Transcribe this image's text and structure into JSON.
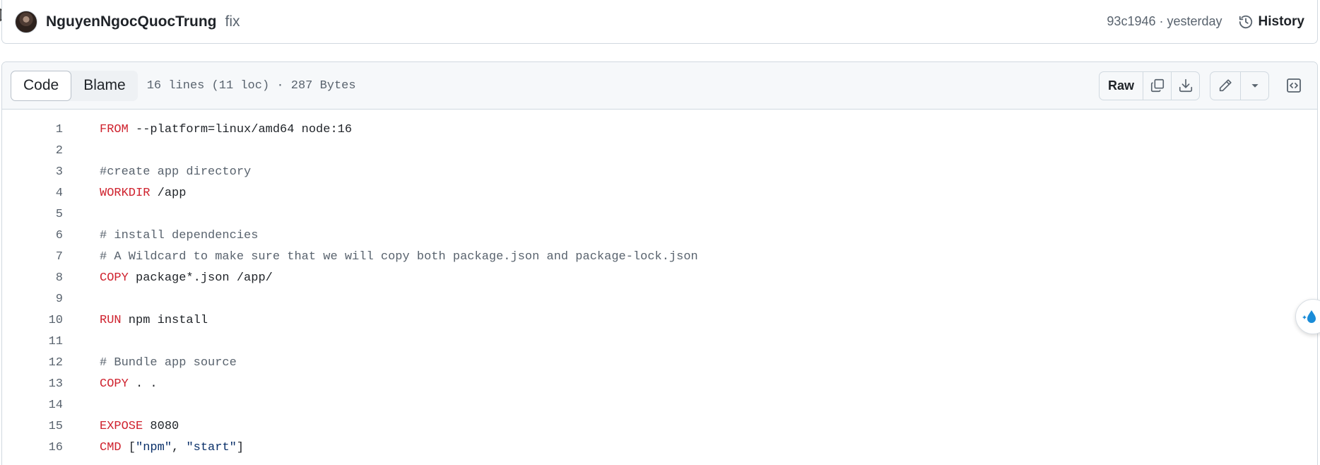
{
  "commit": {
    "author": "NguyenNgocQuocTrung",
    "message": "fix",
    "meta": "93c1946 · yesterday",
    "history_label": "History"
  },
  "file": {
    "tabs": [
      {
        "label": "Code",
        "active": true
      },
      {
        "label": "Blame",
        "active": false
      }
    ],
    "info": "16 lines (11 loc) · 287 Bytes",
    "actions": {
      "raw_label": "Raw",
      "copy_icon": "copy-icon",
      "download_icon": "download-icon",
      "edit_icon": "pencil-icon",
      "more_icon": "triangle-down-icon",
      "symbols_icon": "code-square-icon"
    }
  },
  "code_lines": [
    {
      "n": "1",
      "kw": "FROM",
      "rest": " --platform=linux/amd64 node:16"
    },
    {
      "n": "2",
      "kw": "",
      "rest": ""
    },
    {
      "n": "3",
      "cm": "#create app directory"
    },
    {
      "n": "4",
      "kw": "WORKDIR",
      "rest": " /app"
    },
    {
      "n": "5",
      "kw": "",
      "rest": ""
    },
    {
      "n": "6",
      "cm": "# install dependencies"
    },
    {
      "n": "7",
      "cm": "# A Wildcard to make sure that we will copy both package.json and package-lock.json"
    },
    {
      "n": "8",
      "kw": "COPY",
      "rest": " package*.json /app/"
    },
    {
      "n": "9",
      "kw": "",
      "rest": ""
    },
    {
      "n": "10",
      "kw": "RUN",
      "rest": " npm install"
    },
    {
      "n": "11",
      "kw": "",
      "rest": ""
    },
    {
      "n": "12",
      "cm": "# Bundle app source"
    },
    {
      "n": "13",
      "kw": "COPY",
      "rest": " . ."
    },
    {
      "n": "14",
      "kw": "",
      "rest": ""
    },
    {
      "n": "15",
      "kw": "EXPOSE",
      "rest": " 8080"
    },
    {
      "n": "16",
      "kw": "CMD",
      "rest": " [",
      "parts": [
        "\"npm\"",
        ", ",
        "\"start\"",
        "]"
      ]
    }
  ],
  "colors": {
    "keyword": "#cf222e",
    "comment": "#59636e",
    "string": "#0a3069",
    "border": "#d1d9e0",
    "header_bg": "#f6f8fa"
  }
}
